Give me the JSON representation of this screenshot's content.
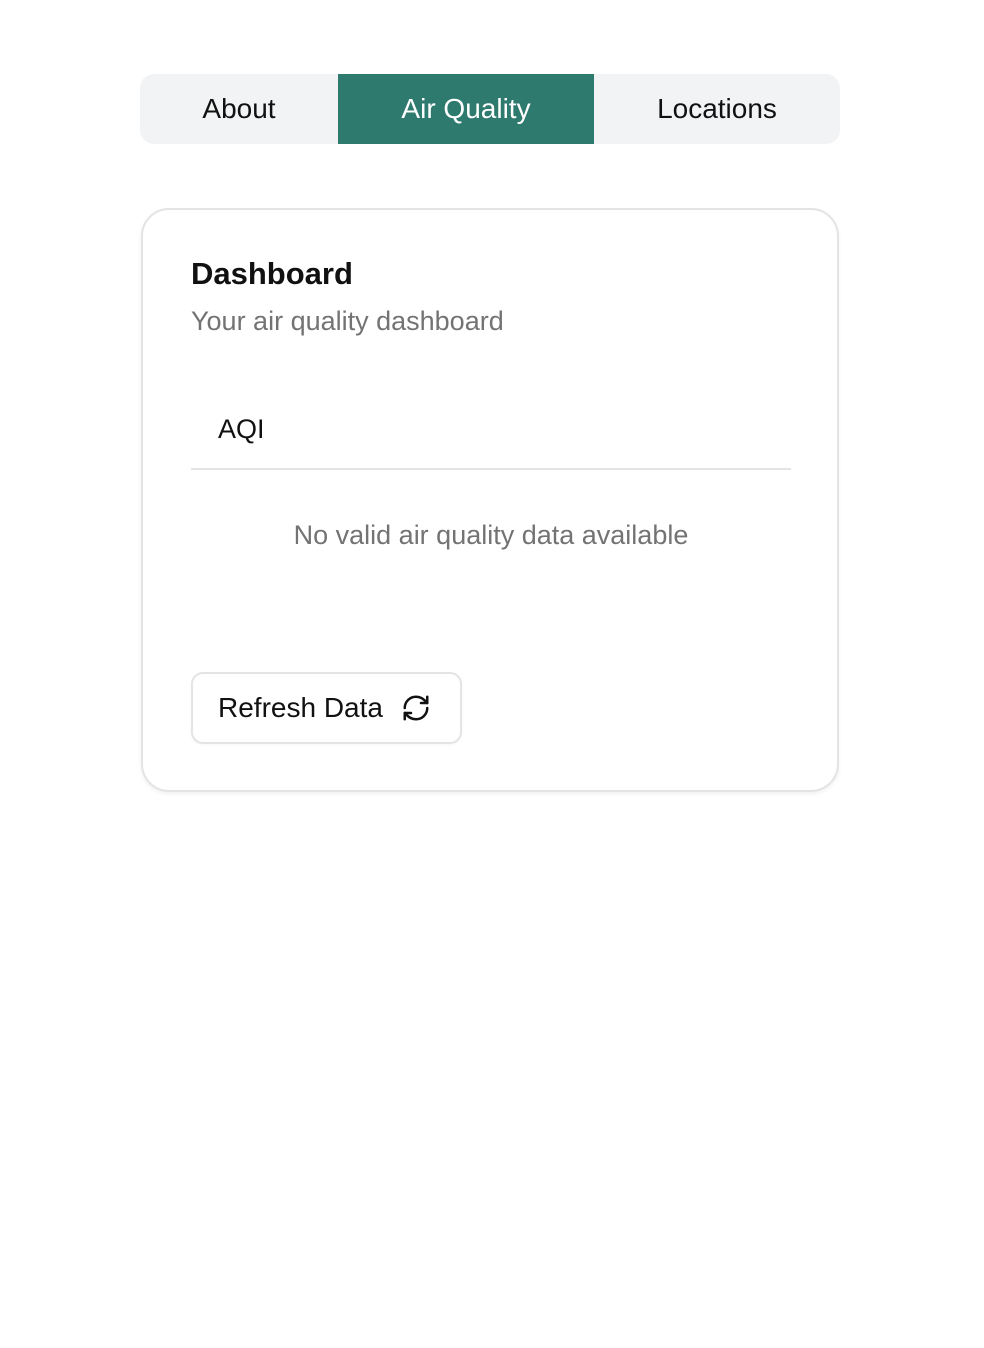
{
  "tabs": [
    {
      "label": "About",
      "active": false
    },
    {
      "label": "Air Quality",
      "active": true
    },
    {
      "label": "Locations",
      "active": false
    }
  ],
  "accent_color": "#2e7a6e",
  "card": {
    "title": "Dashboard",
    "subtitle": "Your air quality dashboard",
    "table": {
      "columns": [
        "AQI"
      ],
      "rows": []
    },
    "empty_message": "No valid air quality data available",
    "refresh_button": {
      "label": "Refresh Data",
      "icon": "refresh-icon"
    }
  }
}
